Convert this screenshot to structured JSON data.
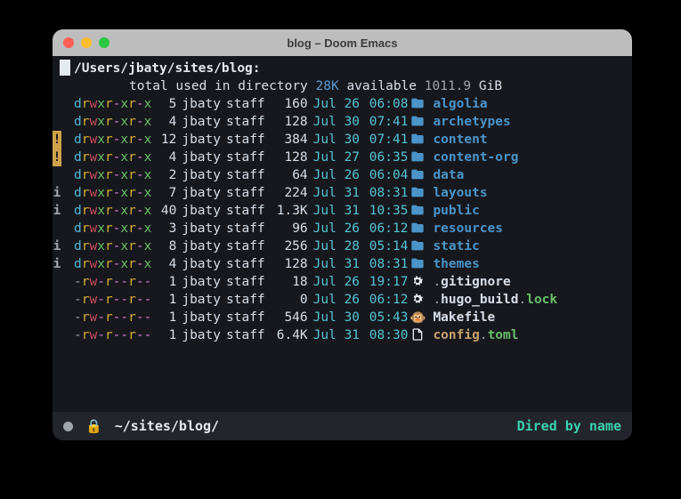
{
  "window": {
    "title": "blog – Doom Emacs"
  },
  "header": {
    "path": "/Users/jbaty/sites/blog:"
  },
  "totals": {
    "prefix": "total used in directory ",
    "used": "28K",
    "mid": " available ",
    "avail": "1011.9",
    "unit": " GiB"
  },
  "rows": [
    {
      "mark": "",
      "mark_kind": "",
      "perm": "drwxr-xr-x",
      "links": "5",
      "owner": "jbaty",
      "group": "staff",
      "size": "160",
      "date": "Jul 26",
      "time": "06:08",
      "icon": "folder",
      "name": "algolia",
      "kind": "dir"
    },
    {
      "mark": "",
      "mark_kind": "",
      "perm": "drwxr-xr-x",
      "links": "4",
      "owner": "jbaty",
      "group": "staff",
      "size": "128",
      "date": "Jul 30",
      "time": "07:41",
      "icon": "folder",
      "name": "archetypes",
      "kind": "dir"
    },
    {
      "mark": "!",
      "mark_kind": "warn",
      "perm": "drwxr-xr-x",
      "links": "12",
      "owner": "jbaty",
      "group": "staff",
      "size": "384",
      "date": "Jul 30",
      "time": "07:41",
      "icon": "folder",
      "name": "content",
      "kind": "dir"
    },
    {
      "mark": "!",
      "mark_kind": "warn",
      "perm": "drwxr-xr-x",
      "links": "4",
      "owner": "jbaty",
      "group": "staff",
      "size": "128",
      "date": "Jul 27",
      "time": "06:35",
      "icon": "folder",
      "name": "content-org",
      "kind": "dir"
    },
    {
      "mark": "",
      "mark_kind": "",
      "perm": "drwxr-xr-x",
      "links": "2",
      "owner": "jbaty",
      "group": "staff",
      "size": "64",
      "date": "Jul 26",
      "time": "06:04",
      "icon": "folder",
      "name": "data",
      "kind": "dir"
    },
    {
      "mark": "i",
      "mark_kind": "info",
      "perm": "drwxr-xr-x",
      "links": "7",
      "owner": "jbaty",
      "group": "staff",
      "size": "224",
      "date": "Jul 31",
      "time": "08:31",
      "icon": "folder",
      "name": "layouts",
      "kind": "dir"
    },
    {
      "mark": "i",
      "mark_kind": "info",
      "perm": "drwxr-xr-x",
      "links": "40",
      "owner": "jbaty",
      "group": "staff",
      "size": "1.3K",
      "date": "Jul 31",
      "time": "10:35",
      "icon": "folder",
      "name": "public",
      "kind": "dir"
    },
    {
      "mark": "",
      "mark_kind": "",
      "perm": "drwxr-xr-x",
      "links": "3",
      "owner": "jbaty",
      "group": "staff",
      "size": "96",
      "date": "Jul 26",
      "time": "06:12",
      "icon": "folder",
      "name": "resources",
      "kind": "dir"
    },
    {
      "mark": "i",
      "mark_kind": "info",
      "perm": "drwxr-xr-x",
      "links": "8",
      "owner": "jbaty",
      "group": "staff",
      "size": "256",
      "date": "Jul 28",
      "time": "05:14",
      "icon": "folder",
      "name": "static",
      "kind": "dir"
    },
    {
      "mark": "i",
      "mark_kind": "info",
      "perm": "drwxr-xr-x",
      "links": "4",
      "owner": "jbaty",
      "group": "staff",
      "size": "128",
      "date": "Jul 31",
      "time": "08:31",
      "icon": "folder",
      "name": "themes",
      "kind": "dir"
    },
    {
      "mark": "",
      "mark_kind": "",
      "perm": "-rw-r--r--",
      "links": "1",
      "owner": "jbaty",
      "group": "staff",
      "size": "18",
      "date": "Jul 26",
      "time": "19:17",
      "icon": "gear",
      "name": ".gitignore",
      "kind": "dotfile"
    },
    {
      "mark": "",
      "mark_kind": "",
      "perm": "-rw-r--r--",
      "links": "1",
      "owner": "jbaty",
      "group": "staff",
      "size": "0",
      "date": "Jul 26",
      "time": "06:12",
      "icon": "gear",
      "name": ".hugo_build",
      "ext": "lock",
      "kind": "dotfile"
    },
    {
      "mark": "",
      "mark_kind": "",
      "perm": "-rw-r--r--",
      "links": "1",
      "owner": "jbaty",
      "group": "staff",
      "size": "546",
      "date": "Jul 30",
      "time": "05:43",
      "icon": "monkey",
      "name": "Makefile",
      "kind": "plain"
    },
    {
      "mark": "",
      "mark_kind": "",
      "perm": "-rw-r--r--",
      "links": "1",
      "owner": "jbaty",
      "group": "staff",
      "size": "6.4K",
      "date": "Jul 31",
      "time": "08:30",
      "icon": "file",
      "name": "config",
      "ext": "toml",
      "kind": "config"
    }
  ],
  "modeline": {
    "path": "~/sites/blog/",
    "mode": "Dired by name"
  }
}
